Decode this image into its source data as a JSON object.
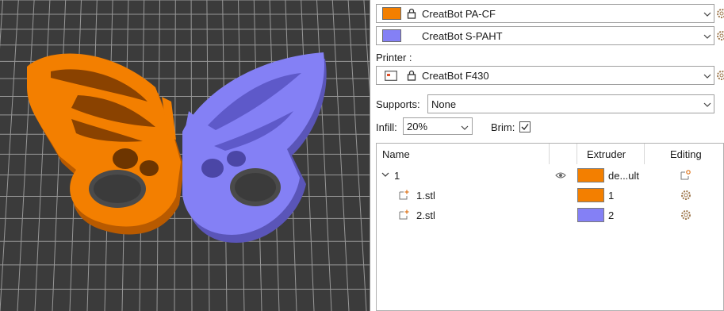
{
  "filaments": [
    {
      "name": "CreatBot PA-CF",
      "color": "#f37f00",
      "locked": true
    },
    {
      "name": "CreatBot S-PAHT",
      "color": "#8480f5",
      "locked": false
    }
  ],
  "printer": {
    "label": "Printer :",
    "name": "CreatBot F430"
  },
  "supports": {
    "label": "Supports:",
    "value": "None"
  },
  "infill": {
    "label": "Infill:",
    "value": "20%"
  },
  "brim": {
    "label": "Brim:",
    "checked": true
  },
  "object_list": {
    "headers": {
      "name": "Name",
      "extruder": "Extruder",
      "editing": "Editing"
    },
    "rows": [
      {
        "name": "1",
        "extruder": "de...ult",
        "color": "#f37f00",
        "level": 0
      },
      {
        "name": "1.stl",
        "extruder": "1",
        "color": "#f37f00",
        "level": 1
      },
      {
        "name": "2.stl",
        "extruder": "2",
        "color": "#8480f5",
        "level": 1
      }
    ]
  },
  "colors": {
    "orange": "#f37f00",
    "purple": "#8480f5",
    "viewport_bg": "#3d3d3d",
    "grid": "#9a9a9a"
  }
}
